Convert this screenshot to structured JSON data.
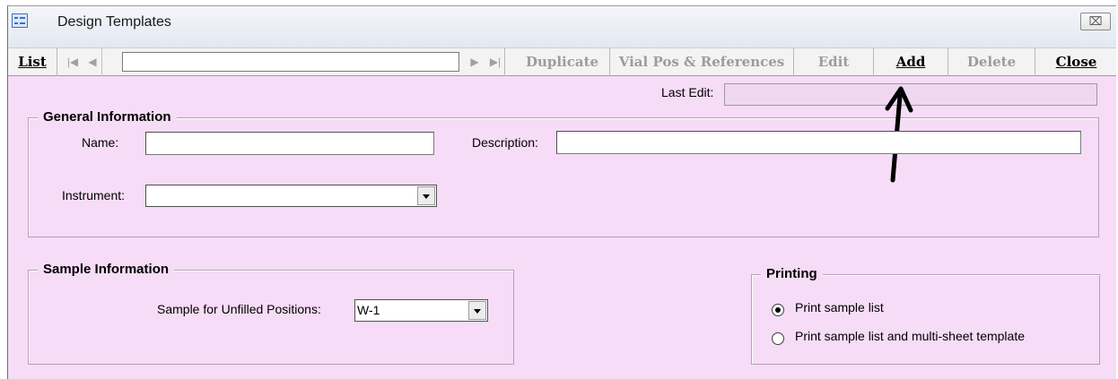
{
  "window": {
    "title": "Design Templates",
    "close_glyph": "⌧"
  },
  "toolbar": {
    "list_label": "List",
    "nav": {
      "first": "|◀",
      "prev": "◀",
      "next": "▶",
      "last": "▶|"
    },
    "record_value": "",
    "duplicate_label": "Duplicate",
    "vial_label": "Vial Pos & References",
    "edit_label": "Edit",
    "add_label": "Add",
    "delete_label": "Delete",
    "close_label": "Close"
  },
  "form": {
    "last_edit_label": "Last Edit:",
    "last_edit_value": "",
    "general": {
      "title": "General Information",
      "name_label": "Name:",
      "name_value": "",
      "description_label": "Description:",
      "description_value": "",
      "instrument_label": "Instrument:",
      "instrument_value": ""
    },
    "sample": {
      "title": "Sample Information",
      "unfilled_label": "Sample for Unfilled Positions:",
      "unfilled_value": "W-1"
    },
    "printing": {
      "title": "Printing",
      "options": [
        {
          "label": "Print sample list",
          "checked": true
        },
        {
          "label": "Print sample list and multi-sheet template",
          "checked": false
        }
      ]
    }
  },
  "colors": {
    "form_bg": "#f6dcf6",
    "toolbar_bg": "#f3f3f3"
  }
}
